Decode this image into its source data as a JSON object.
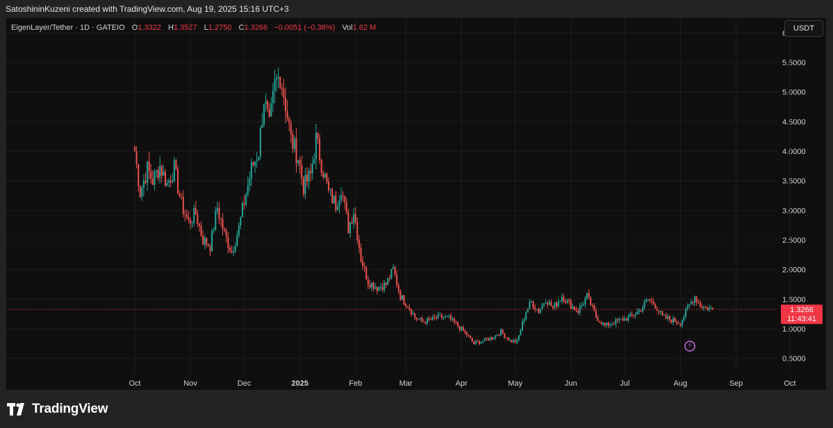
{
  "caption": "SatoshininKuzeni created with TradingView.com, Aug 19, 2025 15:16 UTC+3",
  "legend": {
    "symbol": "EigenLayer/Tether · 1D · GATEIO",
    "o_label": "O",
    "o_value": "1.3322",
    "h_label": "H",
    "h_value": "1.3527",
    "l_label": "L",
    "l_value": "1.2750",
    "c_label": "C",
    "c_value": "1.3266",
    "change": "−0.0051 (−0.38%)",
    "vol_label": "Vol",
    "vol_value": "1.62 M"
  },
  "currency_button": "USDT",
  "brand_name": "TradingView",
  "colors": {
    "up": "#26a69a",
    "down": "#ef5350",
    "grid": "#1e1e1e",
    "last_price": "#f23645"
  },
  "icons": {
    "flash": "flash-icon",
    "logo": "tradingview-logo-icon"
  },
  "chart_data": {
    "type": "candlestick",
    "x_ticks": [
      {
        "label": "Oct",
        "date": "2024-10-01"
      },
      {
        "label": "Nov",
        "date": "2024-11-01"
      },
      {
        "label": "Dec",
        "date": "2024-12-01"
      },
      {
        "label": "2025",
        "date": "2025-01-01"
      },
      {
        "label": "Feb",
        "date": "2025-02-01"
      },
      {
        "label": "Mar",
        "date": "2025-03-01"
      },
      {
        "label": "Apr",
        "date": "2025-04-01"
      },
      {
        "label": "May",
        "date": "2025-05-01"
      },
      {
        "label": "Jun",
        "date": "2025-06-01"
      },
      {
        "label": "Jul",
        "date": "2025-07-01"
      },
      {
        "label": "Aug",
        "date": "2025-08-01"
      },
      {
        "label": "Sep",
        "date": "2025-09-01"
      },
      {
        "label": "Oct",
        "date": "2025-10-01"
      }
    ],
    "y_ticks": [
      "6.0000",
      "5.5000",
      "5.0000",
      "4.5000",
      "4.0000",
      "3.5000",
      "3.0000",
      "2.5000",
      "2.0000",
      "1.5000",
      "1.0000",
      "0.5000"
    ],
    "ylim": [
      0.25,
      6.25
    ],
    "last_price": "1.3266",
    "countdown": "11:43:41",
    "close_path": [
      {
        "date": "2024-10-01",
        "close": 4.0
      },
      {
        "date": "2024-10-04",
        "close": 3.3
      },
      {
        "date": "2024-10-08",
        "close": 3.7
      },
      {
        "date": "2024-10-11",
        "close": 3.5
      },
      {
        "date": "2024-10-15",
        "close": 3.75
      },
      {
        "date": "2024-10-19",
        "close": 3.45
      },
      {
        "date": "2024-10-23",
        "close": 3.7
      },
      {
        "date": "2024-10-27",
        "close": 3.1
      },
      {
        "date": "2024-10-31",
        "close": 2.8
      },
      {
        "date": "2024-11-04",
        "close": 2.95
      },
      {
        "date": "2024-11-08",
        "close": 2.5
      },
      {
        "date": "2024-11-12",
        "close": 2.4
      },
      {
        "date": "2024-11-16",
        "close": 3.05
      },
      {
        "date": "2024-11-20",
        "close": 2.6
      },
      {
        "date": "2024-11-24",
        "close": 2.3
      },
      {
        "date": "2024-11-28",
        "close": 2.7
      },
      {
        "date": "2024-12-01",
        "close": 3.15
      },
      {
        "date": "2024-12-05",
        "close": 3.7
      },
      {
        "date": "2024-12-09",
        "close": 4.0
      },
      {
        "date": "2024-12-12",
        "close": 4.9
      },
      {
        "date": "2024-12-15",
        "close": 4.4
      },
      {
        "date": "2024-12-18",
        "close": 5.1
      },
      {
        "date": "2024-12-21",
        "close": 5.3
      },
      {
        "date": "2024-12-24",
        "close": 4.8
      },
      {
        "date": "2024-12-27",
        "close": 4.2
      },
      {
        "date": "2024-12-31",
        "close": 3.9
      },
      {
        "date": "2025-01-03",
        "close": 3.4
      },
      {
        "date": "2025-01-07",
        "close": 3.6
      },
      {
        "date": "2025-01-10",
        "close": 4.2
      },
      {
        "date": "2025-01-13",
        "close": 3.8
      },
      {
        "date": "2025-01-17",
        "close": 3.3
      },
      {
        "date": "2025-01-21",
        "close": 3.1
      },
      {
        "date": "2025-01-24",
        "close": 3.4
      },
      {
        "date": "2025-01-28",
        "close": 2.7
      },
      {
        "date": "2025-01-31",
        "close": 3.0
      },
      {
        "date": "2025-02-04",
        "close": 2.2
      },
      {
        "date": "2025-02-08",
        "close": 1.8
      },
      {
        "date": "2025-02-13",
        "close": 1.7
      },
      {
        "date": "2025-02-18",
        "close": 1.75
      },
      {
        "date": "2025-02-22",
        "close": 2.0
      },
      {
        "date": "2025-02-26",
        "close": 1.55
      },
      {
        "date": "2025-03-02",
        "close": 1.4
      },
      {
        "date": "2025-03-06",
        "close": 1.2
      },
      {
        "date": "2025-03-10",
        "close": 1.12
      },
      {
        "date": "2025-03-15",
        "close": 1.15
      },
      {
        "date": "2025-03-20",
        "close": 1.2
      },
      {
        "date": "2025-03-25",
        "close": 1.18
      },
      {
        "date": "2025-03-30",
        "close": 1.05
      },
      {
        "date": "2025-04-04",
        "close": 0.9
      },
      {
        "date": "2025-04-08",
        "close": 0.75
      },
      {
        "date": "2025-04-13",
        "close": 0.8
      },
      {
        "date": "2025-04-18",
        "close": 0.85
      },
      {
        "date": "2025-04-23",
        "close": 0.95
      },
      {
        "date": "2025-04-28",
        "close": 0.8
      },
      {
        "date": "2025-05-02",
        "close": 0.78
      },
      {
        "date": "2025-05-07",
        "close": 1.3
      },
      {
        "date": "2025-05-10",
        "close": 1.45
      },
      {
        "date": "2025-05-14",
        "close": 1.3
      },
      {
        "date": "2025-05-18",
        "close": 1.5
      },
      {
        "date": "2025-05-22",
        "close": 1.35
      },
      {
        "date": "2025-05-27",
        "close": 1.55
      },
      {
        "date": "2025-06-01",
        "close": 1.4
      },
      {
        "date": "2025-06-05",
        "close": 1.3
      },
      {
        "date": "2025-06-10",
        "close": 1.55
      },
      {
        "date": "2025-06-15",
        "close": 1.2
      },
      {
        "date": "2025-06-20",
        "close": 1.05
      },
      {
        "date": "2025-06-24",
        "close": 1.1
      },
      {
        "date": "2025-06-29",
        "close": 1.15
      },
      {
        "date": "2025-07-04",
        "close": 1.2
      },
      {
        "date": "2025-07-09",
        "close": 1.3
      },
      {
        "date": "2025-07-14",
        "close": 1.5
      },
      {
        "date": "2025-07-18",
        "close": 1.4
      },
      {
        "date": "2025-07-22",
        "close": 1.2
      },
      {
        "date": "2025-07-27",
        "close": 1.15
      },
      {
        "date": "2025-08-01",
        "close": 1.1
      },
      {
        "date": "2025-08-05",
        "close": 1.35
      },
      {
        "date": "2025-08-09",
        "close": 1.55
      },
      {
        "date": "2025-08-12",
        "close": 1.4
      },
      {
        "date": "2025-08-16",
        "close": 1.35
      },
      {
        "date": "2025-08-19",
        "close": 1.33
      }
    ]
  }
}
